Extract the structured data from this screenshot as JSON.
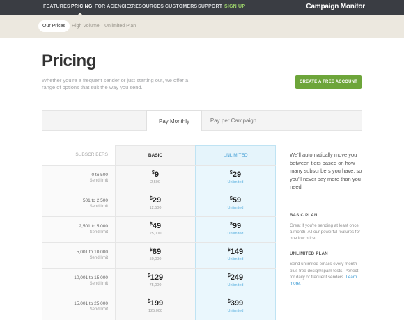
{
  "nav": {
    "items": [
      {
        "label": "FEATURES"
      },
      {
        "label": "PRICING"
      },
      {
        "label": "FOR AGENCIES"
      },
      {
        "label": "RESOURCES"
      },
      {
        "label": "CUSTOMERS"
      },
      {
        "label": "SUPPORT"
      },
      {
        "label": "SIGN UP"
      }
    ],
    "brand": "Campaign Monitor",
    "signup_color": "#9bd16a"
  },
  "subnav": {
    "items": [
      {
        "label": "Our Prices"
      },
      {
        "label": "High Volume"
      },
      {
        "label": "Unlimited Plan"
      }
    ]
  },
  "header": {
    "title": "Pricing",
    "intro": "Whether you're a frequent sender or just starting out, we offer a range of options that suit the way you send.",
    "cta_label": "CREATE A FREE ACCOUNT",
    "cta_color": "#6da53a"
  },
  "tabs": [
    {
      "label": "Pay Monthly"
    },
    {
      "label": "Pay per Campaign"
    }
  ],
  "pricing": {
    "headers": {
      "subscribers": "SUBSCRIBERS",
      "basic": "BASIC",
      "unlimited": "UNLIMITED"
    },
    "currency": "$",
    "rows": [
      {
        "range": "0 to 500",
        "limit_label": "Send limit",
        "basic_price": "9",
        "basic_limit": "2,500",
        "unl_price": "29",
        "unl_limit": "Unlimited"
      },
      {
        "range": "501 to 2,500",
        "limit_label": "Send limit",
        "basic_price": "29",
        "basic_limit": "12,500",
        "unl_price": "59",
        "unl_limit": "Unlimited"
      },
      {
        "range": "2,501 to 5,000",
        "limit_label": "Send limit",
        "basic_price": "49",
        "basic_limit": "25,000",
        "unl_price": "99",
        "unl_limit": "Unlimited"
      },
      {
        "range": "5,001 to 10,000",
        "limit_label": "Send limit",
        "basic_price": "89",
        "basic_limit": "50,000",
        "unl_price": "149",
        "unl_limit": "Unlimited"
      },
      {
        "range": "10,001 to 15,000",
        "limit_label": "Send limit",
        "basic_price": "129",
        "basic_limit": "75,000",
        "unl_price": "249",
        "unl_limit": "Unlimited"
      },
      {
        "range": "15,001 to 25,000",
        "limit_label": "Send limit",
        "basic_price": "199",
        "basic_limit": "125,000",
        "unl_price": "399",
        "unl_limit": "Unlimited"
      }
    ]
  },
  "sidebar": {
    "intro": "We'll automatically move you between tiers based on how many subscribers you have, so you'll never pay more than you need.",
    "basic_title": "BASIC PLAN",
    "basic_text": "Great if you're sending at least once a month. All our powerful features for one low price.",
    "unl_title": "UNLIMITED PLAN",
    "unl_text": "Send unlimited emails every month plus free design/spam tests. Perfect for daily or frequent senders.",
    "learn_more": "Learn more."
  },
  "colors": {
    "accent_blue": "#3b9ad3",
    "nav_bg": "#3a3d43",
    "subnav_bg": "#ece8df"
  }
}
